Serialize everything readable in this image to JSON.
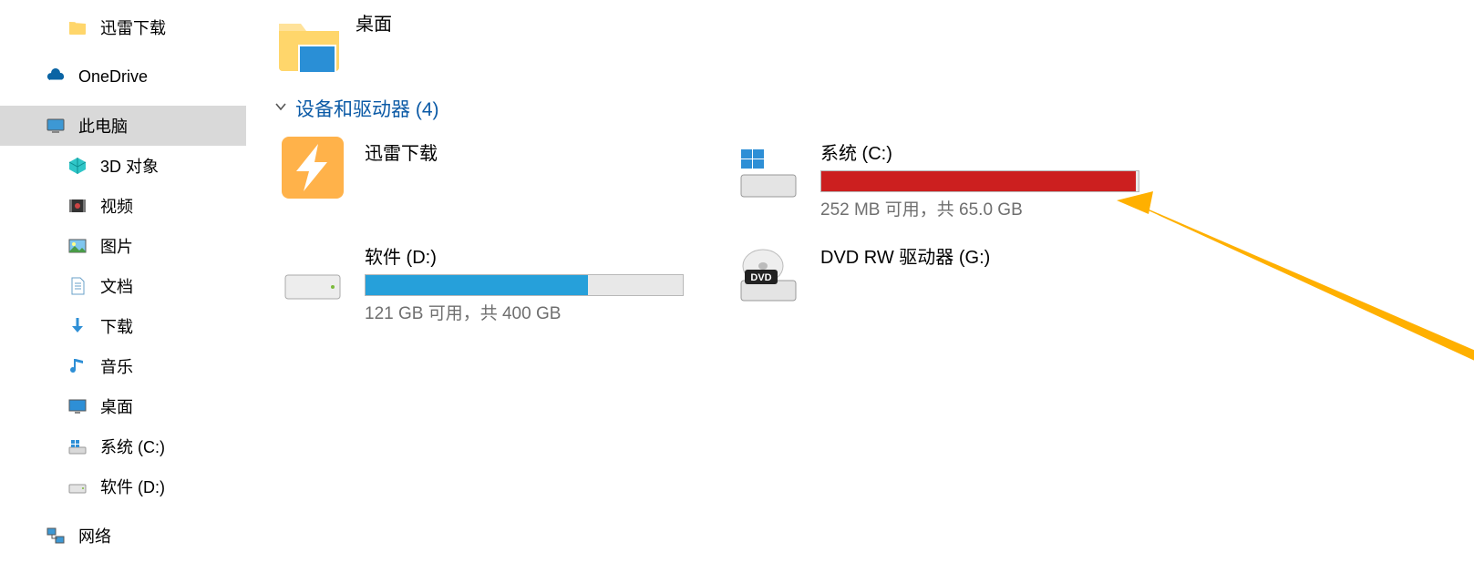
{
  "sidebar": {
    "items": [
      {
        "label": "迅雷下载",
        "icon": "folder-yellow",
        "level": 2
      },
      {
        "label": "OneDrive",
        "icon": "onedrive",
        "level": 1
      },
      {
        "label": "此电脑",
        "icon": "pc",
        "level": 1,
        "selected": true
      },
      {
        "label": "3D 对象",
        "icon": "cube",
        "level": 2
      },
      {
        "label": "视频",
        "icon": "video",
        "level": 2
      },
      {
        "label": "图片",
        "icon": "picture",
        "level": 2
      },
      {
        "label": "文档",
        "icon": "document",
        "level": 2
      },
      {
        "label": "下载",
        "icon": "download",
        "level": 2
      },
      {
        "label": "音乐",
        "icon": "music",
        "level": 2
      },
      {
        "label": "桌面",
        "icon": "desktop",
        "level": 2
      },
      {
        "label": "系统 (C:)",
        "icon": "drive-win",
        "level": 2
      },
      {
        "label": "软件 (D:)",
        "icon": "drive",
        "level": 2
      },
      {
        "label": "网络",
        "icon": "network",
        "level": 1
      }
    ]
  },
  "content": {
    "topFolder": {
      "label": "桌面"
    },
    "sectionHeader": "设备和驱动器 (4)",
    "drives": [
      {
        "name": "迅雷下载",
        "kind": "app-folder",
        "icon": "xunlei"
      },
      {
        "name": "系统 (C:)",
        "kind": "drive",
        "icon": "drive-win",
        "barColor": "#cc1f1f",
        "barPct": 99,
        "sub": "252 MB 可用，共 65.0 GB"
      },
      {
        "name": "软件 (D:)",
        "kind": "drive",
        "icon": "drive",
        "barColor": "#26a0da",
        "barPct": 70,
        "sub": "121 GB 可用，共 400 GB"
      },
      {
        "name": "DVD RW 驱动器 (G:)",
        "kind": "dvd",
        "icon": "dvd"
      }
    ]
  }
}
